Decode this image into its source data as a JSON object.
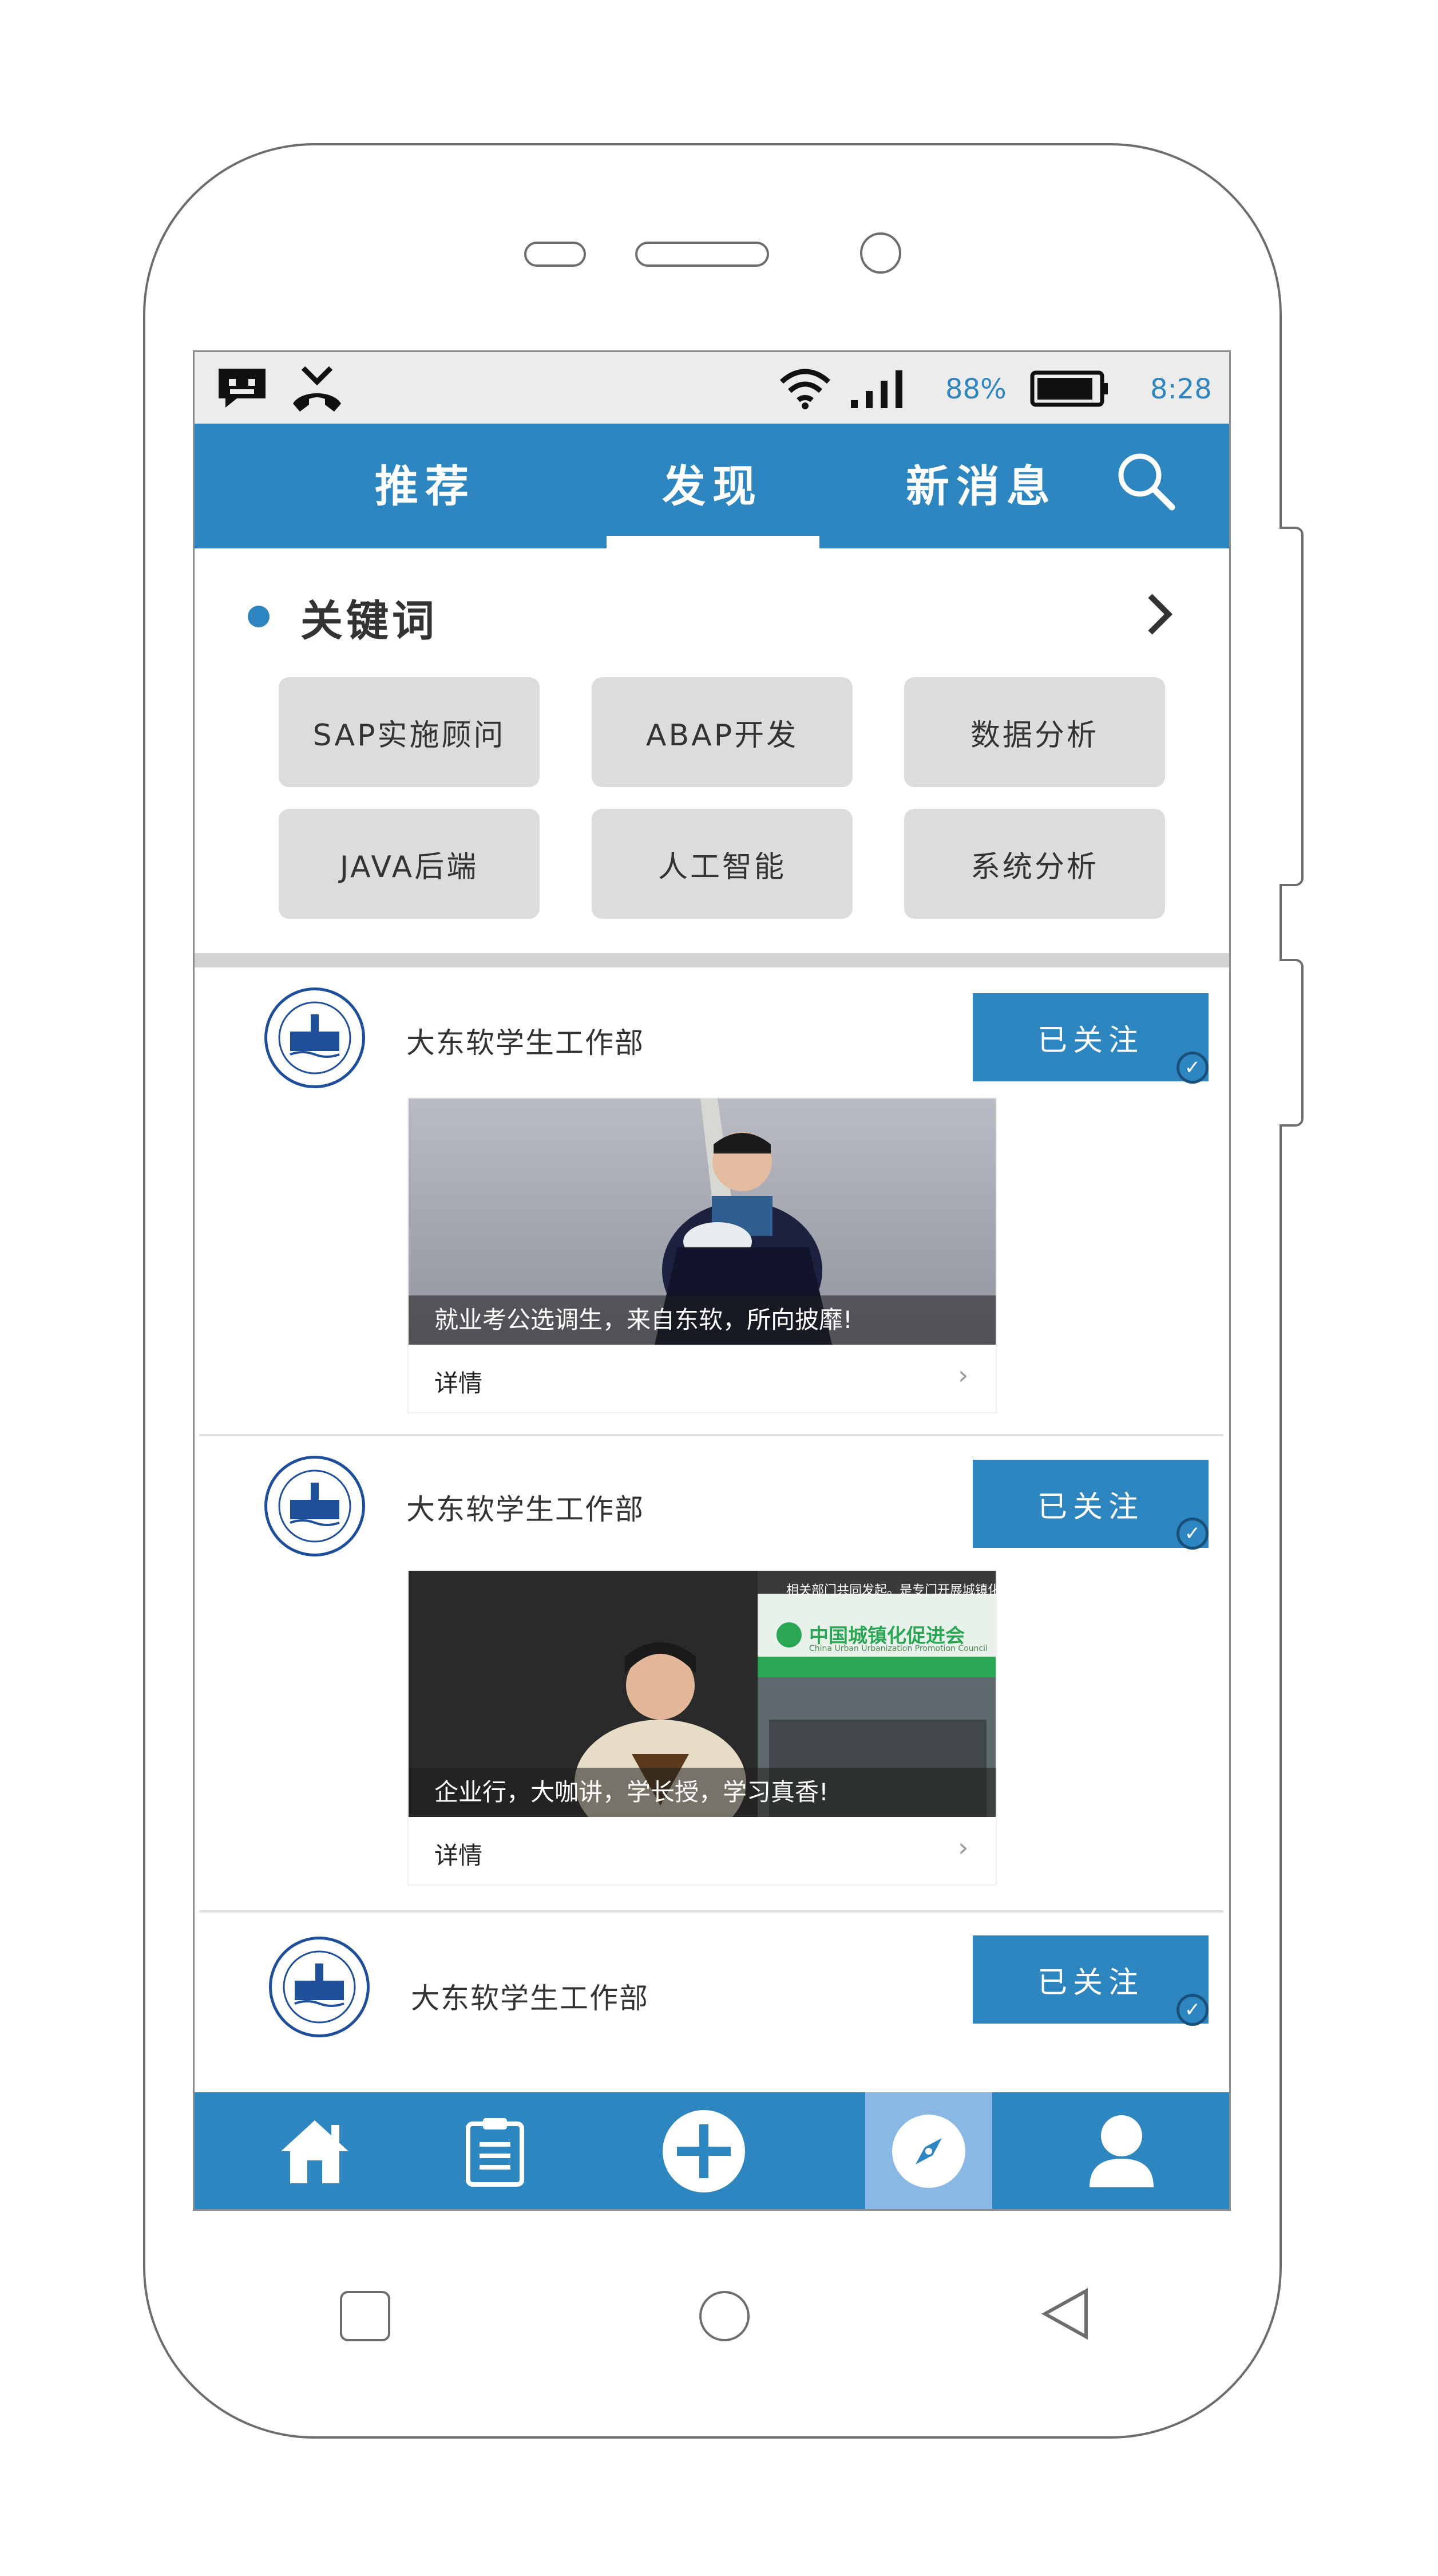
{
  "status_bar": {
    "battery_percent": "88%",
    "time": "8:28",
    "icons": [
      "message-icon",
      "missed-call-icon",
      "wifi-icon",
      "signal-icon",
      "battery-icon"
    ]
  },
  "top_nav": {
    "tabs": [
      {
        "label": "推荐",
        "active": false
      },
      {
        "label": "发现",
        "active": true
      },
      {
        "label": "新消息",
        "active": false
      }
    ],
    "search_icon": "search-icon"
  },
  "keywords": {
    "title": "关键词",
    "items": [
      "SAP实施顾问",
      "ABAP开发",
      "数据分析",
      "JAVA后端",
      "人工智能",
      "系统分析"
    ]
  },
  "feed": [
    {
      "org_name": "大东软学生工作部",
      "follow_label": "已关注",
      "caption": "就业考公选调生，来自东软，所向披靡!",
      "detail_label": "详情"
    },
    {
      "org_name": "大东软学生工作部",
      "follow_label": "已关注",
      "caption": "企业行，大咖讲，学长授，学习真香!",
      "detail_label": "详情",
      "image_text": {
        "banner_top": "相关部门共同发起。是专门开展城镇化研",
        "logo_text": "中国城镇化促进会",
        "logo_sub": "China Urban Urbanization Promotion Council"
      }
    },
    {
      "org_name": "大东软学生工作部",
      "follow_label": "已关注"
    }
  ],
  "bottom_nav": {
    "items": [
      "home-icon",
      "clipboard-icon",
      "add-icon",
      "compass-icon",
      "profile-icon"
    ],
    "active_index": 3
  },
  "colors": {
    "primary": "#2e86c1",
    "chip_bg": "#dcdcdc",
    "active_tab_bg": "#89b8e4"
  }
}
